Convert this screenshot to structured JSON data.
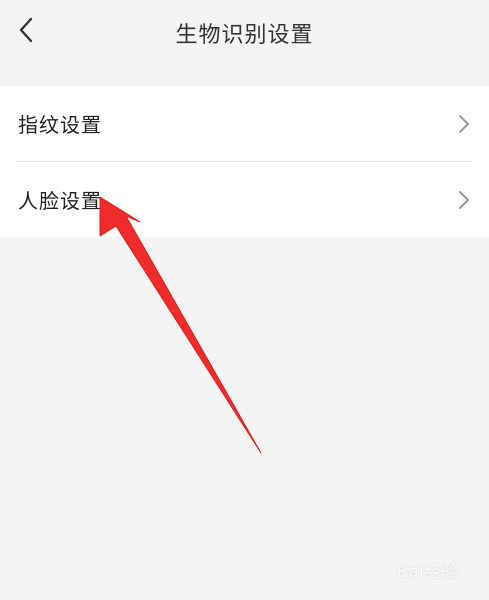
{
  "header": {
    "title": "生物识别设置",
    "back_icon": "chevron-left-icon"
  },
  "settings": {
    "items": [
      {
        "label": "指纹设置",
        "icon": "chevron-right-icon"
      },
      {
        "label": "人脸设置",
        "icon": "chevron-right-icon"
      }
    ]
  },
  "annotation": {
    "arrow_color": "#f02b2b"
  },
  "watermark": {
    "text": "Bai经验"
  },
  "colors": {
    "background": "#f4f4f4",
    "card": "#ffffff",
    "divider": "#e6e6e6",
    "chevron": "#9a9a9a"
  }
}
